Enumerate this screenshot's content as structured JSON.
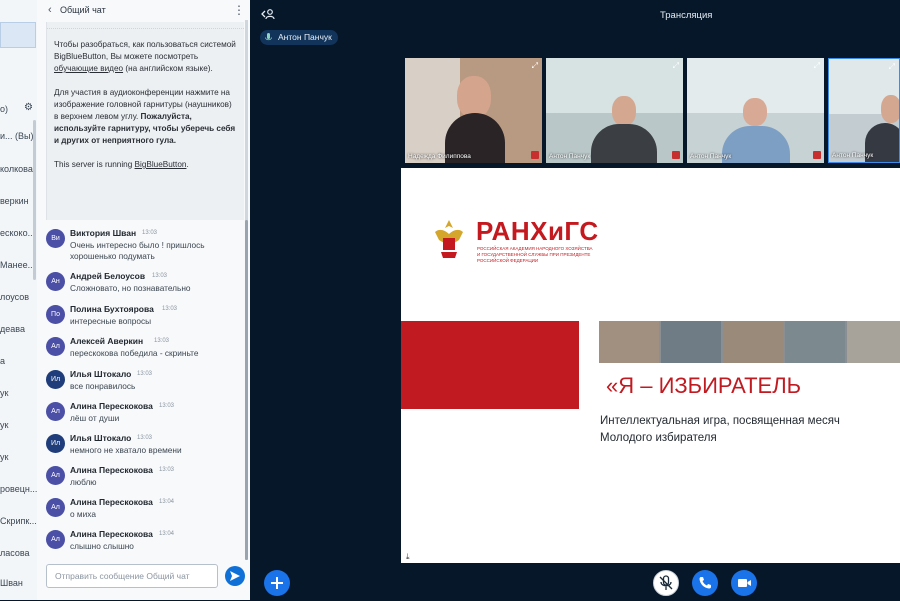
{
  "userlist": {
    "items": [
      "о)",
      "и... (Вы)",
      "колкова",
      "веркин",
      "ескоко...",
      "Манее...",
      "лоусов",
      "деава",
      "а",
      "ук",
      "ук",
      "ук",
      "ровецн...",
      "Скрипк...",
      "ласова",
      "Шван"
    ]
  },
  "chat": {
    "title": "Общий чат",
    "welcome": {
      "p1a": "Чтобы разобраться, как пользоваться системой BigBlueButton, Вы можете посмотреть ",
      "p1link": "обучающие видео",
      "p1b": " (на английском языке).",
      "p2a": "Для участия в аудиоконференции нажмите на изображение головной гарнитуры (наушников) в верхнем левом углу. ",
      "p2b": "Пожалуйста, используйте гарнитуру, чтобы уберечь себя и других от неприятного гула.",
      "p3a": "This server is running ",
      "p3link": "BigBlueButton",
      "p3b": "."
    },
    "messages": [
      {
        "initials": "Ви",
        "name": "Виктория Шван",
        "time": "13:03",
        "text": "Очень интересно было ! пришлось",
        "text2": "хорошенько подумать",
        "color": "#4b4fa6"
      },
      {
        "initials": "Ан",
        "name": "Андрей Белоусов",
        "time": "13:03",
        "text": "Сложновато, но познавательно",
        "color": "#4b4fa6"
      },
      {
        "initials": "По",
        "name": "Полина Бухтоярова",
        "time": "13:03",
        "text": "интересные вопросы",
        "color": "#4b4fa6"
      },
      {
        "initials": "Ал",
        "name": "Алексей Аверкин",
        "time": "13:03",
        "text": "перескокова победила - скриньте",
        "color": "#4b4fa6"
      },
      {
        "initials": "Ил",
        "name": "Илья Штокало",
        "time": "13:03",
        "text": "все понравилось",
        "color": "#1f3d7a"
      },
      {
        "initials": "Ал",
        "name": "Алина Перескокова",
        "time": "13:03",
        "text": "лёш от души",
        "color": "#4b4fa6"
      },
      {
        "initials": "Ил",
        "name": "Илья Штокало",
        "time": "13:03",
        "text": "немного не хватало времени",
        "color": "#1f3d7a"
      },
      {
        "initials": "Ал",
        "name": "Алина Перескокова",
        "time": "13:03",
        "text": "люблю",
        "color": "#4b4fa6"
      },
      {
        "initials": "Ал",
        "name": "Алина Перескокова",
        "time": "13:04",
        "text": "о миха",
        "color": "#4b4fa6"
      },
      {
        "initials": "Ал",
        "name": "Алина Перескокова",
        "time": "13:04",
        "text": "слышно слышно",
        "color": "#4b4fa6"
      }
    ],
    "input_placeholder": "Отправить сообщение Общий чат"
  },
  "main": {
    "title": "Трансляция",
    "presenter": "Антон Панчук",
    "videos": [
      {
        "label": "Надежда Филиппова",
        "bg": "#c9a98e"
      },
      {
        "label": "Антон Панчук",
        "bg": "#b9c7c8"
      },
      {
        "label": "Антон Панчук",
        "bg": "#c7d2d4"
      },
      {
        "label": "Антон Панчук",
        "bg": "#c3ccd1"
      }
    ],
    "slide": {
      "logo": "РАНХиГС",
      "logo_sub": "РОССИЙСКАЯ АКАДЕМИЯ НАРОДНОГО ХОЗЯЙСТВА И ГОСУДАРСТВЕННОЙ СЛУЖБЫ ПРИ ПРЕЗИДЕНТЕ РОССИЙСКОЙ ФЕДЕРАЦИИ",
      "headline": "«Я – ИЗБИРАТЕЛЬ",
      "subline1": "Интеллектуальная игра, посвященная месяч",
      "subline2": "Молодого избирателя"
    }
  },
  "colors": {
    "accent": "#1a73e8",
    "brand_red": "#c11a21",
    "main_bg": "#06172a"
  }
}
